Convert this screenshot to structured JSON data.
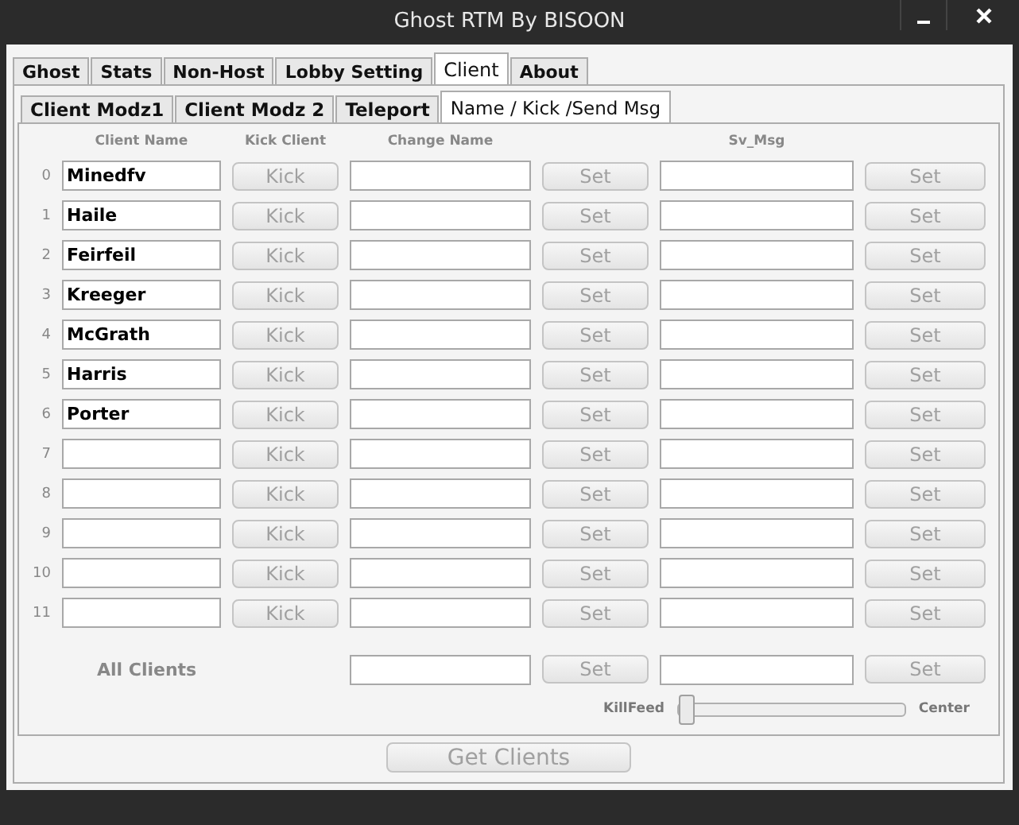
{
  "window": {
    "title": "Ghost RTM By BISOON"
  },
  "tabs": [
    {
      "label": "Ghost",
      "selected": false
    },
    {
      "label": "Stats",
      "selected": false
    },
    {
      "label": "Non-Host",
      "selected": false
    },
    {
      "label": "Lobby Setting",
      "selected": false
    },
    {
      "label": "Client",
      "selected": true
    },
    {
      "label": "About",
      "selected": false
    }
  ],
  "subtabs": [
    {
      "label": "Client Modz1",
      "selected": false
    },
    {
      "label": "Client Modz 2",
      "selected": false
    },
    {
      "label": "Teleport",
      "selected": false
    },
    {
      "label": "Name / Kick /Send Msg",
      "selected": true
    }
  ],
  "columns": [
    "Client Name",
    "Kick Client",
    "Change Name",
    "Sv_Msg"
  ],
  "rows": [
    {
      "index": "0",
      "name": "Minedfv",
      "kick": {
        "label": "Kick",
        "disabled": true
      },
      "set_name": {
        "label": "Set",
        "disabled": true
      },
      "set_msg": {
        "label": "Set",
        "disabled": true
      }
    },
    {
      "index": "1",
      "name": "Haile",
      "kick": {
        "label": "Kick",
        "disabled": true
      },
      "set_name": {
        "label": "Set",
        "disabled": true
      },
      "set_msg": {
        "label": "Set",
        "disabled": true
      }
    },
    {
      "index": "2",
      "name": "Feirfeil",
      "kick": {
        "label": "Kick",
        "disabled": true
      },
      "set_name": {
        "label": "Set",
        "disabled": true
      },
      "set_msg": {
        "label": "Set",
        "disabled": true
      }
    },
    {
      "index": "3",
      "name": "Kreeger",
      "kick": {
        "label": "Kick",
        "disabled": true
      },
      "set_name": {
        "label": "Set",
        "disabled": true
      },
      "set_msg": {
        "label": "Set",
        "disabled": true
      }
    },
    {
      "index": "4",
      "name": "McGrath",
      "kick": {
        "label": "Kick",
        "disabled": true
      },
      "set_name": {
        "label": "Set",
        "disabled": true
      },
      "set_msg": {
        "label": "Set",
        "disabled": true
      }
    },
    {
      "index": "5",
      "name": "Harris",
      "kick": {
        "label": "Kick",
        "disabled": true
      },
      "set_name": {
        "label": "Set",
        "disabled": true
      },
      "set_msg": {
        "label": "Set",
        "disabled": true
      }
    },
    {
      "index": "6",
      "name": "Porter",
      "kick": {
        "label": "Kick",
        "disabled": true
      },
      "set_name": {
        "label": "Set",
        "disabled": true
      },
      "set_msg": {
        "label": "Set",
        "disabled": true
      }
    },
    {
      "index": "7",
      "kick": {
        "label": "Kick",
        "disabled": true
      },
      "set_name": {
        "label": "Set",
        "disabled": true
      },
      "set_msg": {
        "label": "Set",
        "disabled": true
      }
    },
    {
      "index": "8",
      "kick": {
        "label": "Kick",
        "disabled": true
      },
      "set_name": {
        "label": "Set",
        "disabled": true
      },
      "set_msg": {
        "label": "Set",
        "disabled": true
      }
    },
    {
      "index": "9",
      "kick": {
        "label": "Kick",
        "disabled": true
      },
      "set_name": {
        "label": "Set",
        "disabled": true
      },
      "set_msg": {
        "label": "Set",
        "disabled": true
      }
    },
    {
      "index": "10",
      "kick": {
        "label": "Kick",
        "disabled": true
      },
      "set_name": {
        "label": "Set",
        "disabled": true
      },
      "set_msg": {
        "label": "Set",
        "disabled": true
      }
    },
    {
      "index": "11",
      "kick": {
        "label": "Kick",
        "disabled": true
      },
      "set_name": {
        "label": "Set",
        "disabled": true
      },
      "set_msg": {
        "label": "Set",
        "disabled": true
      }
    }
  ],
  "all_clients": {
    "label": "All Clients",
    "set_name": {
      "label": "Set",
      "disabled": true
    },
    "set_msg": {
      "label": "Set",
      "disabled": true
    }
  },
  "killfeed": {
    "label": "KillFeed",
    "level": 0,
    "end_label": "Center"
  },
  "get_clients": {
    "label": "Get Clients",
    "disabled": true
  }
}
